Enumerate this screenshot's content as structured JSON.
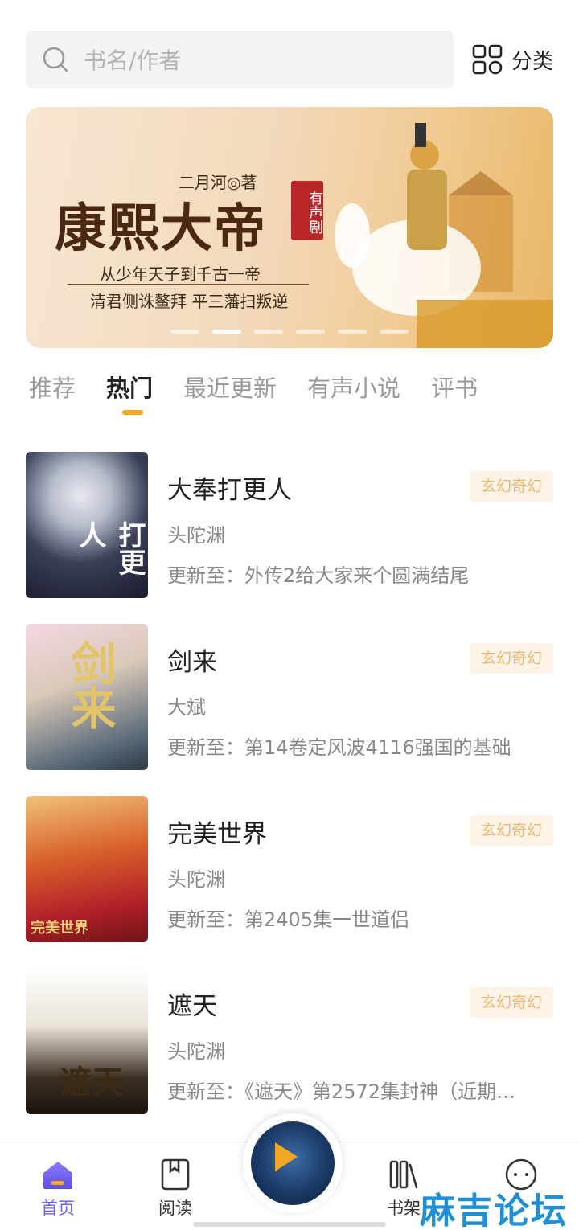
{
  "search": {
    "placeholder": "书名/作者"
  },
  "category": {
    "label": "分类"
  },
  "banner": {
    "author": "二月河◎著",
    "title": "康熙大帝",
    "badge": "有声剧",
    "line1": "从少年天子到千古一帝",
    "line2": "清君侧诛鳌拜 平三藩扫叛逆",
    "active_dot": 1,
    "dot_count": 6
  },
  "tabs": [
    {
      "label": "推荐",
      "active": false
    },
    {
      "label": "热门",
      "active": true
    },
    {
      "label": "最近更新",
      "active": false
    },
    {
      "label": "有声小说",
      "active": false
    },
    {
      "label": "评书",
      "active": false
    }
  ],
  "books": [
    {
      "title": "大奉打更人",
      "author": "头陀渊",
      "update": "更新至：外传2给大家来个圆满结尾",
      "genre": "玄幻奇幻",
      "cover_text": "打更人"
    },
    {
      "title": "剑来",
      "author": "大斌",
      "update": "更新至：第14卷定风波4116强国的基础",
      "genre": "玄幻奇幻",
      "cover_text": "剑来"
    },
    {
      "title": "完美世界",
      "author": "头陀渊",
      "update": "更新至：第2405集一世道侣",
      "genre": "玄幻奇幻",
      "cover_text": "完美世界"
    },
    {
      "title": "遮天",
      "author": "头陀渊",
      "update": "更新至：《遮天》第2572集封神（近期…",
      "genre": "玄幻奇幻",
      "cover_text": "遮天"
    }
  ],
  "nav": {
    "home": "首页",
    "read": "阅读",
    "shelf": "书架"
  },
  "watermark": "麻吉论坛",
  "colors": {
    "accent": "#f5a623",
    "nav_active": "#6c63ff",
    "genre_text": "#e9b872",
    "genre_bg": "#fdf3e6"
  }
}
